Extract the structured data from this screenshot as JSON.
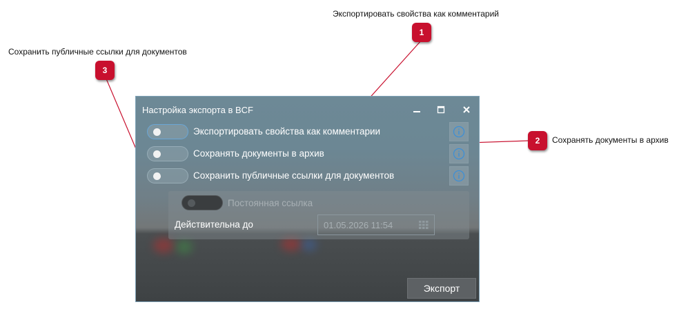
{
  "callouts": [
    {
      "number": "1",
      "text": "Экспортировать свойства как комментарий"
    },
    {
      "number": "2",
      "text": "Сохранять документы в архив"
    },
    {
      "number": "3",
      "text": "Сохранить публичные ссылки для документов"
    }
  ],
  "colors": {
    "badge": "#c8102e",
    "leader_line": "#c8102e",
    "info_icon": "#3d8fd6",
    "dialog_border": "#7fa3b8"
  },
  "dialog": {
    "title": "Настройка экспорта в BCF",
    "window_controls": [
      "minimize-icon",
      "maximize-icon",
      "close-icon"
    ],
    "options": [
      {
        "label": "Экспортировать свойства как комментарии",
        "enabled": false,
        "info_icon": "info-icon"
      },
      {
        "label": "Сохранять документы в архив",
        "enabled": false,
        "info_icon": "info-icon"
      },
      {
        "label": "Сохранить публичные ссылки для документов",
        "enabled": false,
        "info_icon": "info-icon"
      }
    ],
    "link_settings": {
      "permanent_link_label": "Постоянная ссылка",
      "permanent_link_enabled": false,
      "valid_until_label": "Действительна до",
      "valid_until_value": "01.05.2026 11:54",
      "calendar_icon": "calendar-icon"
    },
    "export_button": "Экспорт"
  }
}
